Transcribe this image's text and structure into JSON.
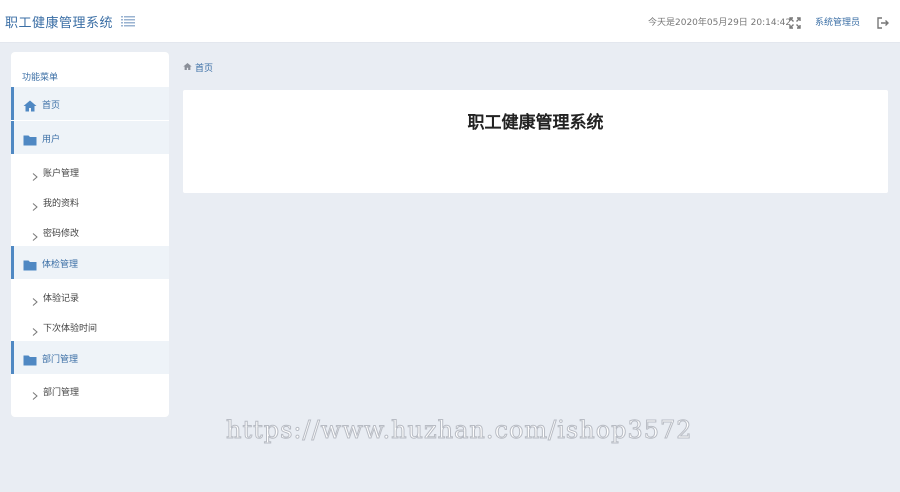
{
  "header": {
    "app_title": "职工健康管理系统",
    "datetime": "今天是2020年05月29日 20:14:42",
    "admin_label": "系统管理员"
  },
  "sidebar": {
    "caption": "功能菜单",
    "groups": [
      {
        "label": "首页",
        "icon": "home-icon",
        "items": []
      },
      {
        "label": "用户",
        "icon": "folder-icon",
        "items": [
          "账户管理",
          "我的资料",
          "密码修改"
        ]
      },
      {
        "label": "体检管理",
        "icon": "folder-icon",
        "items": [
          "体验记录",
          "下次体验时间"
        ]
      },
      {
        "label": "部门管理",
        "icon": "folder-icon",
        "items": [
          "部门管理"
        ]
      }
    ]
  },
  "breadcrumb": {
    "home_label": "首页"
  },
  "main": {
    "card_title": "职工健康管理系统"
  },
  "watermark": "https://www.huzhan.com/ishop3572",
  "colors": {
    "accent": "#3a6ea5",
    "page_bg": "#e9edf3",
    "active_bg": "#eef3f8",
    "border_accent": "#4f88c3"
  }
}
